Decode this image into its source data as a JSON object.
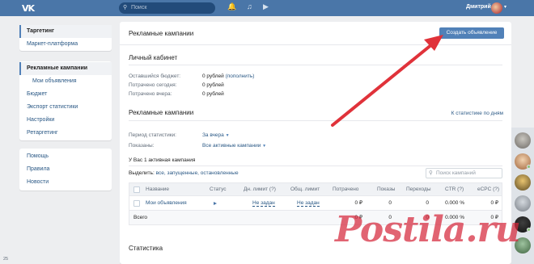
{
  "header": {
    "logo": "VK",
    "search_placeholder": "Поиск",
    "user_name": "Дмитрий"
  },
  "leftnav": {
    "group1": [
      {
        "label": "Таргетинг",
        "active": true
      },
      {
        "label": "Маркет-платформа"
      }
    ],
    "group2": [
      {
        "label": "Рекламные кампании",
        "active": true
      },
      {
        "label": "Мои объявления",
        "sub": true
      },
      {
        "label": "Бюджет"
      },
      {
        "label": "Экспорт статистики"
      },
      {
        "label": "Настройки"
      },
      {
        "label": "Ретаргетинг"
      }
    ],
    "group3": [
      {
        "label": "Помощь"
      },
      {
        "label": "Правила"
      },
      {
        "label": "Новости"
      }
    ]
  },
  "main": {
    "title": "Рекламные кампании",
    "create_button": "Создать объявление",
    "cabinet": {
      "heading": "Личный кабинет",
      "rows": [
        {
          "label": "Оставшийся бюджет:",
          "value": "0 рублей",
          "link": "(пополнить)"
        },
        {
          "label": "Потрачено сегодня:",
          "value": "0 рублей"
        },
        {
          "label": "Потрачено вчера:",
          "value": "0 рублей"
        }
      ]
    },
    "campaigns": {
      "heading": "Рекламные кампании",
      "stats_link": "К статистике по дням",
      "period_label": "Период статистики:",
      "period_value": "За вчера",
      "shown_label": "Показаны:",
      "shown_value": "Все активные кампании",
      "count_note": "У Вас 1 активная кампания",
      "filter_label": "Выделить:",
      "filter_links": "все, запущенные, остановленные",
      "search_placeholder": "Поиск кампаний",
      "columns": [
        "Название",
        "Статус",
        "Дн. лимит (?)",
        "Общ. лимит",
        "Потрачено",
        "Показы",
        "Переходы",
        "CTR (?)",
        "eCPC (?)"
      ],
      "row": {
        "name": "Мои объявления",
        "day_limit": "Не задан",
        "total_limit": "Не задан",
        "spent": "0 ₽",
        "views": "0",
        "clicks": "0",
        "ctr": "0.000 %",
        "ecpc": "0 ₽"
      },
      "total": {
        "label": "Всего",
        "spent": "0 ₽",
        "views": "0",
        "clicks": "0",
        "ctr": "0.000 %",
        "ecpc": "0 ₽"
      }
    },
    "stats_heading": "Статистика"
  },
  "right_bar": {
    "count": "25"
  },
  "watermark": "Postila.ru",
  "colors": {
    "header": "#4a76a8",
    "accent": "#5181b8",
    "link": "#2a5885",
    "arrow": "#e0323a"
  }
}
